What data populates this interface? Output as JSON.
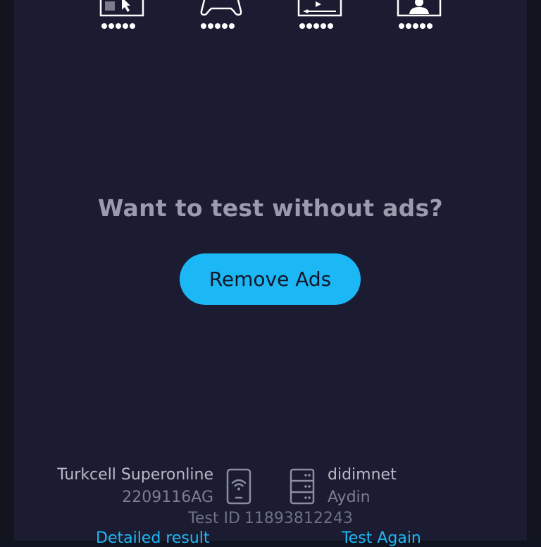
{
  "rating_row": {
    "items": [
      {
        "icon": "web-browsing-icon",
        "dots": 5
      },
      {
        "icon": "gaming-controller-icon",
        "dots": 5
      },
      {
        "icon": "video-streaming-icon",
        "dots": 5
      },
      {
        "icon": "video-call-icon",
        "dots": 5
      }
    ]
  },
  "promo": {
    "title": "Want to test without ads?",
    "button_label": "Remove Ads"
  },
  "connection": {
    "isp_name": "Turkcell Superonline",
    "isp_ip": "2209116AG",
    "server_name": "didimnet",
    "server_city": "Aydin",
    "test_id_label": "Test ID",
    "test_id_value": "11893812243"
  },
  "links": {
    "detailed_result": "Detailed result",
    "test_again": "Test Again"
  },
  "colors": {
    "background": "#1b1c31",
    "accent": "#1cb8f5",
    "muted_text": "#9a9cae"
  }
}
